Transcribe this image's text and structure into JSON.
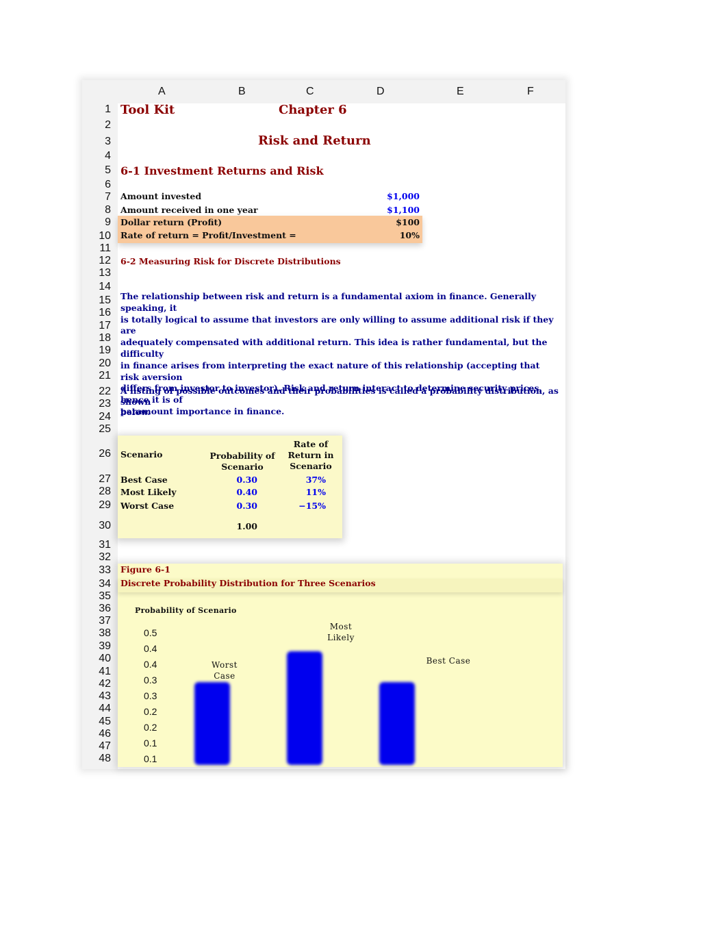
{
  "sheet": {
    "columns": [
      "A",
      "B",
      "C",
      "D",
      "E",
      "F"
    ],
    "rows": [
      "1",
      "2",
      "3",
      "4",
      "5",
      "6",
      "7",
      "8",
      "9",
      "10",
      "11",
      "12",
      "13",
      "14",
      "15",
      "16",
      "17",
      "18",
      "19",
      "20",
      "21",
      "22",
      "23",
      "24",
      "25",
      "26",
      "27",
      "28",
      "29",
      "30",
      "31",
      "32",
      "33",
      "34",
      "35",
      "36",
      "37",
      "38",
      "39",
      "40",
      "41",
      "42",
      "43",
      "44",
      "45",
      "46",
      "47",
      "48"
    ]
  },
  "header": {
    "tool_kit": "Tool Kit",
    "chapter": "Chapter 6",
    "title": "Risk and Return"
  },
  "section1": {
    "heading": "6-1 Investment Returns and Risk",
    "items": [
      {
        "label": "Amount invested",
        "value": "$1,000"
      },
      {
        "label": "Amount received in one year",
        "value": "$1,100"
      },
      {
        "label": "Dollar return (Profit)",
        "value": "$100"
      },
      {
        "label": "Rate of return = Profit/Investment =",
        "value": "10%"
      }
    ]
  },
  "section2": {
    "heading": "6-2 Measuring Risk for Discrete Distributions",
    "paragraph_lines": [
      "The relationship between risk and return is a fundamental axiom in finance.  Generally speaking, it",
      "is totally logical to assume that investors are only willing to assume additional risk if they are",
      "adequately compensated with additional return.  This idea is rather fundamental, but the difficulty",
      "in finance arises from interpreting the exact nature of this relationship (accepting that risk aversion",
      "differs from investor to investor).  Risk and return interact to determine security prices, hence it is of",
      "paramount importance in finance."
    ],
    "listing_lines": [
      "A listing of possible outcomes and their probabilities is called a probability distribution, as shown",
      "below."
    ]
  },
  "prob_table": {
    "headers": {
      "scenario": "Scenario",
      "probability_l1": "Probability of",
      "probability_l2": "Scenario",
      "return_l1": "Rate of",
      "return_l2": "Return in",
      "return_l3": "Scenario"
    },
    "rows": [
      {
        "scenario": "Best Case",
        "probability": "0.30",
        "return": "37%"
      },
      {
        "scenario": "Most Likely",
        "probability": "0.40",
        "return": "11%"
      },
      {
        "scenario": "Worst Case",
        "probability": "0.30",
        "return": "−15%"
      }
    ],
    "total": "1.00"
  },
  "figure": {
    "label": "Figure 6-1",
    "title": "Discrete Probability Distribution for Three Scenarios"
  },
  "chart_data": {
    "type": "bar",
    "title": "Discrete Probability Distribution for Three Scenarios",
    "ylabel": "Probability of Scenario",
    "xlabel": "",
    "categories": [
      "Worst Case",
      "Most Likely",
      "Best Case"
    ],
    "category_labels": [
      [
        "Worst",
        "Case"
      ],
      [
        "Most",
        "Likely"
      ],
      [
        "Best Case"
      ]
    ],
    "values": [
      0.3,
      0.4,
      0.3
    ],
    "y_tick_labels": [
      "0.5",
      "0.4",
      "0.4",
      "0.3",
      "0.3",
      "0.2",
      "0.2",
      "0.1",
      "0.1"
    ],
    "y_tick_values": [
      0.45,
      0.4,
      0.35,
      0.3,
      0.25,
      0.2,
      0.15,
      0.1,
      0.05
    ],
    "ylim": [
      0.05,
      0.45
    ],
    "grid": false,
    "bar_color": "#0000ee"
  }
}
